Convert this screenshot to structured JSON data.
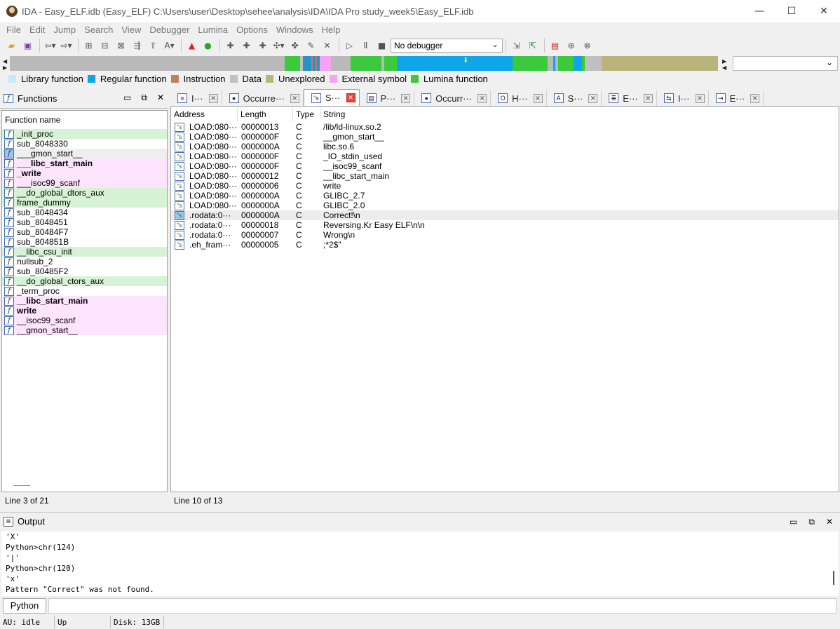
{
  "window": {
    "title": "IDA - Easy_ELF.idb (Easy_ELF) C:\\Users\\user\\Desktop\\sehee\\analysis\\IDA\\IDA Pro study_week5\\Easy_ELF.idb",
    "minimize": "—",
    "maximize": "☐",
    "close": "✕"
  },
  "menu": [
    "File",
    "Edit",
    "Jump",
    "Search",
    "View",
    "Debugger",
    "Lumina",
    "Options",
    "Windows",
    "Help"
  ],
  "toolbar": {
    "debugger_select": "No debugger"
  },
  "legend": [
    {
      "label": "Library function",
      "color": "#c4ecf8"
    },
    {
      "label": "Regular function",
      "color": "#0ea5e9"
    },
    {
      "label": "Instruction",
      "color": "#c07f65"
    },
    {
      "label": "Data",
      "color": "#c0c0c0"
    },
    {
      "label": "Unexplored",
      "color": "#b8b47a"
    },
    {
      "label": "External symbol",
      "color": "#f5a3f2"
    },
    {
      "label": "Lumina function",
      "color": "#3dc93d"
    }
  ],
  "functions": {
    "title": "Functions",
    "column": "Function name",
    "status": "Line 3 of 21",
    "items": [
      {
        "name": "_init_proc",
        "style": "green",
        "bold": false
      },
      {
        "name": "sub_8048330",
        "style": "",
        "bold": false
      },
      {
        "name": "___gmon_start__",
        "style": "grey",
        "bold": false
      },
      {
        "name": "___libc_start_main",
        "style": "pink",
        "bold": true
      },
      {
        "name": "_write",
        "style": "pink",
        "bold": true
      },
      {
        "name": "___isoc99_scanf",
        "style": "pink",
        "bold": false
      },
      {
        "name": "__do_global_dtors_aux",
        "style": "green",
        "bold": false
      },
      {
        "name": "frame_dummy",
        "style": "green",
        "bold": false
      },
      {
        "name": "sub_8048434",
        "style": "",
        "bold": false
      },
      {
        "name": "sub_8048451",
        "style": "",
        "bold": false
      },
      {
        "name": "sub_80484F7",
        "style": "",
        "bold": false
      },
      {
        "name": "sub_804851B",
        "style": "",
        "bold": false
      },
      {
        "name": "__libc_csu_init",
        "style": "green",
        "bold": false
      },
      {
        "name": "nullsub_2",
        "style": "",
        "bold": false
      },
      {
        "name": "sub_80485F2",
        "style": "",
        "bold": false
      },
      {
        "name": "__do_global_ctors_aux",
        "style": "green",
        "bold": false
      },
      {
        "name": "_term_proc",
        "style": "",
        "bold": false
      },
      {
        "name": "__libc_start_main",
        "style": "pink",
        "bold": true
      },
      {
        "name": "write",
        "style": "pink",
        "bold": true
      },
      {
        "name": "__isoc99_scanf",
        "style": "pink",
        "bold": false
      },
      {
        "name": "__gmon_start__",
        "style": "pink",
        "bold": false
      }
    ]
  },
  "tabs": [
    {
      "label": "I···",
      "icon": "≡",
      "active": false
    },
    {
      "label": "Occurre···",
      "icon": "●",
      "active": false
    },
    {
      "label": "S···",
      "icon": "\"s",
      "active": true
    },
    {
      "label": "P···",
      "icon": "▤",
      "active": false
    },
    {
      "label": "Occurr···",
      "icon": "●",
      "active": false
    },
    {
      "label": "H···",
      "icon": "O",
      "active": false
    },
    {
      "label": "S···",
      "icon": "A",
      "active": false
    },
    {
      "label": "E···",
      "icon": "≣",
      "active": false
    },
    {
      "label": "I···",
      "icon": "⇆",
      "active": false
    },
    {
      "label": "E···",
      "icon": "⇥",
      "active": false
    }
  ],
  "strings": {
    "columns": [
      "Address",
      "Length",
      "Type",
      "String"
    ],
    "status": "Line 10 of 13",
    "rows": [
      {
        "address": "LOAD:080···",
        "length": "00000013",
        "type": "C",
        "string": "/lib/ld-linux.so.2"
      },
      {
        "address": "LOAD:080···",
        "length": "0000000F",
        "type": "C",
        "string": "__gmon_start__"
      },
      {
        "address": "LOAD:080···",
        "length": "0000000A",
        "type": "C",
        "string": "libc.so.6"
      },
      {
        "address": "LOAD:080···",
        "length": "0000000F",
        "type": "C",
        "string": "_IO_stdin_used"
      },
      {
        "address": "LOAD:080···",
        "length": "0000000F",
        "type": "C",
        "string": "__isoc99_scanf"
      },
      {
        "address": "LOAD:080···",
        "length": "00000012",
        "type": "C",
        "string": "__libc_start_main"
      },
      {
        "address": "LOAD:080···",
        "length": "00000006",
        "type": "C",
        "string": "write"
      },
      {
        "address": "LOAD:080···",
        "length": "0000000A",
        "type": "C",
        "string": "GLIBC_2.7"
      },
      {
        "address": "LOAD:080···",
        "length": "0000000A",
        "type": "C",
        "string": "GLIBC_2.0"
      },
      {
        "address": ".rodata:0···",
        "length": "0000000A",
        "type": "C",
        "string": "Correct!\\n",
        "selected": true
      },
      {
        "address": ".rodata:0···",
        "length": "00000018",
        "type": "C",
        "string": "Reversing.Kr Easy ELF\\n\\n"
      },
      {
        "address": ".rodata:0···",
        "length": "00000007",
        "type": "C",
        "string": "Wrong\\n"
      },
      {
        "address": ".eh_fram···",
        "length": "00000005",
        "type": "C",
        "string": ";*2$\""
      }
    ]
  },
  "output": {
    "title": "Output",
    "lines": [
      "'X'",
      "Python>chr(124)",
      "'|'",
      "Python>chr(120)",
      "'x'",
      "Pattern \"Correct\" was not found."
    ],
    "lang_button": "Python"
  },
  "statusbar": {
    "au": "AU:  idle",
    "up": "Up",
    "disk": "Disk: 13GB"
  }
}
